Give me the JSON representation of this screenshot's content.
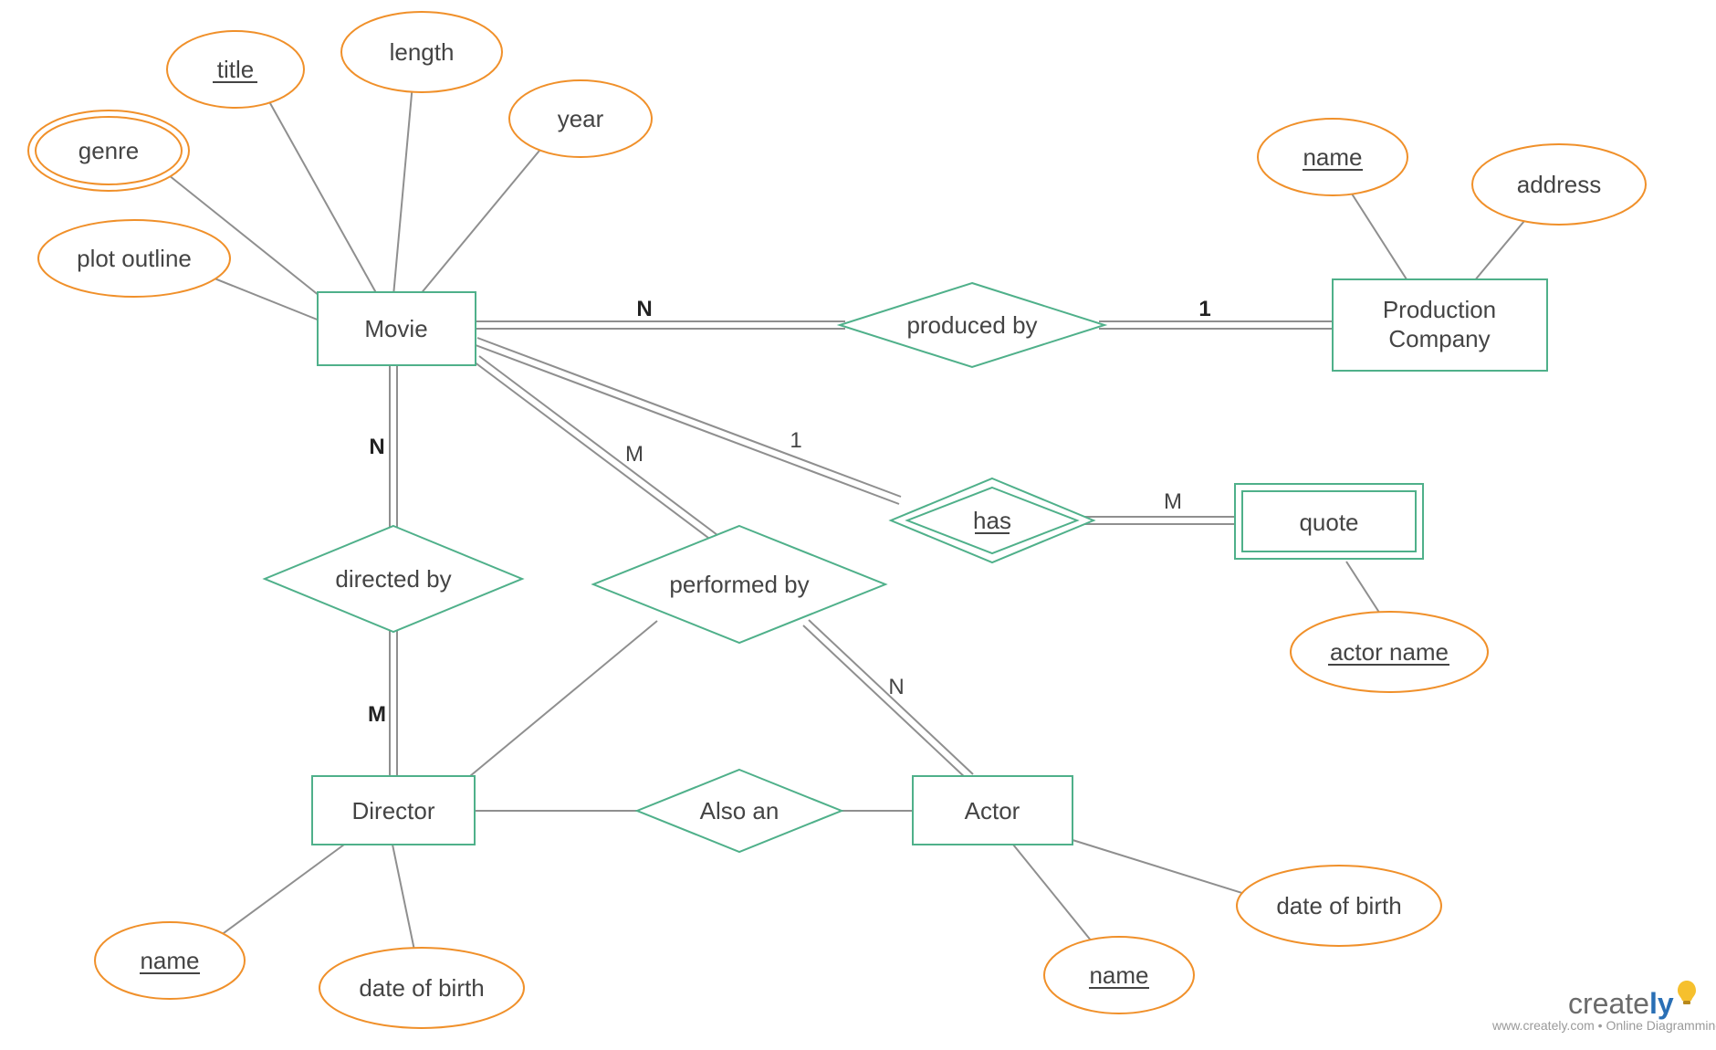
{
  "entities": {
    "movie": "Movie",
    "production_company_l1": "Production",
    "production_company_l2": "Company",
    "director": "Director",
    "actor": "Actor",
    "quote": "quote"
  },
  "attributes": {
    "title": "title",
    "length": "length",
    "year": "year",
    "genre": "genre",
    "plot_outline": "plot outline",
    "prod_name": "name",
    "prod_address": "address",
    "actor_name_attr": "actor name",
    "director_name": "name",
    "director_dob": "date of birth",
    "actor_name": "name",
    "actor_dob": "date of birth"
  },
  "relationships": {
    "produced_by": "produced by",
    "directed_by": "directed by",
    "performed_by": "performed by",
    "also_an": "Also an",
    "has": "has"
  },
  "cardinalities": {
    "movie_produced_N": "N",
    "prod_produced_1": "1",
    "movie_directed_N": "N",
    "director_directed_M": "M",
    "movie_performed_M": "M",
    "actor_performed_N": "N",
    "movie_has_1": "1",
    "quote_has_M": "M"
  },
  "branding": {
    "name_part1": "create",
    "name_part2": "ly",
    "tagline": "www.creately.com • Online Diagramming"
  }
}
